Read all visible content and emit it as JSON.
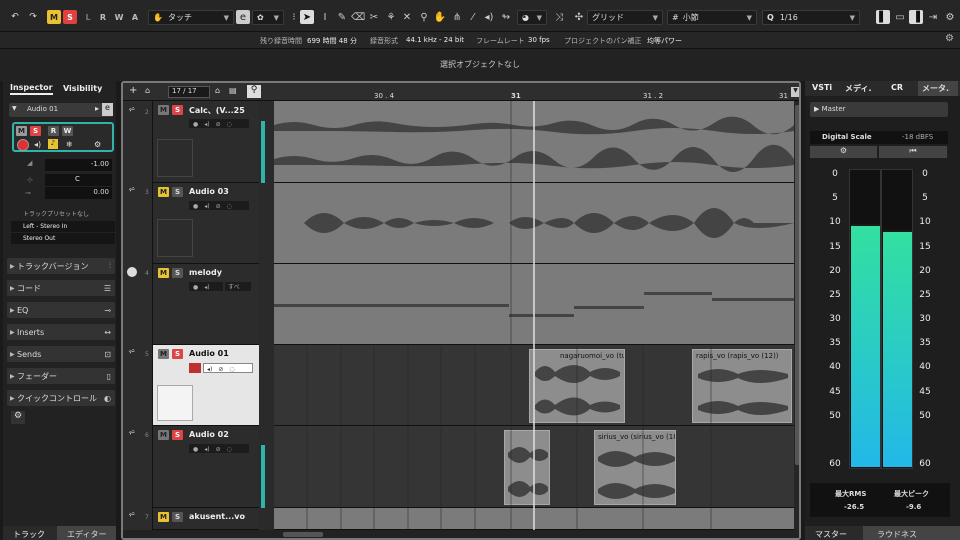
{
  "toolbar": {
    "modes": [
      "M",
      "S",
      "L",
      "R",
      "W",
      "A"
    ],
    "touch_mode": "タッチ",
    "snap_type": "グリッド",
    "grid_type": "小節",
    "quantize": "1/16",
    "quantize_icon": "Q"
  },
  "info": {
    "rec_time_label": "残り録音時間",
    "rec_time_value": "699 時間 48 分",
    "rec_format_label": "録音形式",
    "rec_format_value": "44.1 kHz - 24 bit",
    "framerate_label": "フレームレート",
    "framerate_value": "30 fps",
    "pan_label": "プロジェクトのパン補正",
    "pan_value": "均等パワー"
  },
  "status": "選択オブジェクトなし",
  "inspector": {
    "tab_inspector": "Inspector",
    "tab_visibility": "Visibility",
    "track_name": "Audio 01",
    "volume": "-1.00",
    "pan": "C",
    "zero": "0.00",
    "preset": "トラックプリセットなし",
    "input": "Left - Stereo In",
    "output": "Stereo Out",
    "sections": [
      "トラックバージョン",
      "コード",
      "EQ",
      "Inserts",
      "Sends",
      "フェーダー",
      "クイックコントロール"
    ],
    "bottom_tab_track": "トラック",
    "bottom_tab_editor": "エディター",
    "btn_m": "M",
    "btn_s": "S",
    "btn_r": "R",
    "btn_w": "W"
  },
  "project": {
    "track_count": "17 / 17",
    "ruler": [
      "30 . 4",
      "31",
      "31 . 2",
      "31"
    ],
    "tracks": [
      {
        "num": "2",
        "name": "Calc、(V...25",
        "m": "M",
        "s": "S"
      },
      {
        "num": "3",
        "name": "Audio 03",
        "m": "M",
        "s": "S"
      },
      {
        "num": "4",
        "name": "melody",
        "m": "M",
        "s": "S",
        "extra": "すべ"
      },
      {
        "num": "5",
        "name": "Audio 01",
        "m": "M",
        "s": "S"
      },
      {
        "num": "6",
        "name": "Audio 02",
        "m": "M",
        "s": "S"
      },
      {
        "num": "7",
        "name": "akusent...vo",
        "m": "M",
        "s": "S"
      }
    ],
    "clips": {
      "c1": "nagaruomoi_vo (tu",
      "c2": "rapis_vo (rapis_vo (12))",
      "c3": "sirius_vo (sirius_vo (18"
    }
  },
  "right": {
    "tabs": [
      "VSTi",
      "メディ.",
      "CR",
      "メータ."
    ],
    "master": "Master",
    "digital_scale": "Digital Scale",
    "dbfs": "-18 dBFS",
    "scale": [
      "0",
      "5",
      "10",
      "15",
      "20",
      "25",
      "30",
      "35",
      "40",
      "45",
      "50",
      "60"
    ],
    "max_rms_label": "最大RMS",
    "max_rms": "-26.5",
    "max_peak_label": "最大ピーク",
    "max_peak": "-9.6",
    "bottom_tab_master": "マスター",
    "bottom_tab_loudness": "ラウドネス",
    "meter_left_level": 0.82,
    "meter_right_level": 0.8,
    "meter_color_top": "#33e0a0",
    "meter_color_bottom": "#22b8e8"
  },
  "colors": {
    "mute": "#e8c230",
    "solo": "#e04040",
    "accent": "#2fb5a8"
  }
}
